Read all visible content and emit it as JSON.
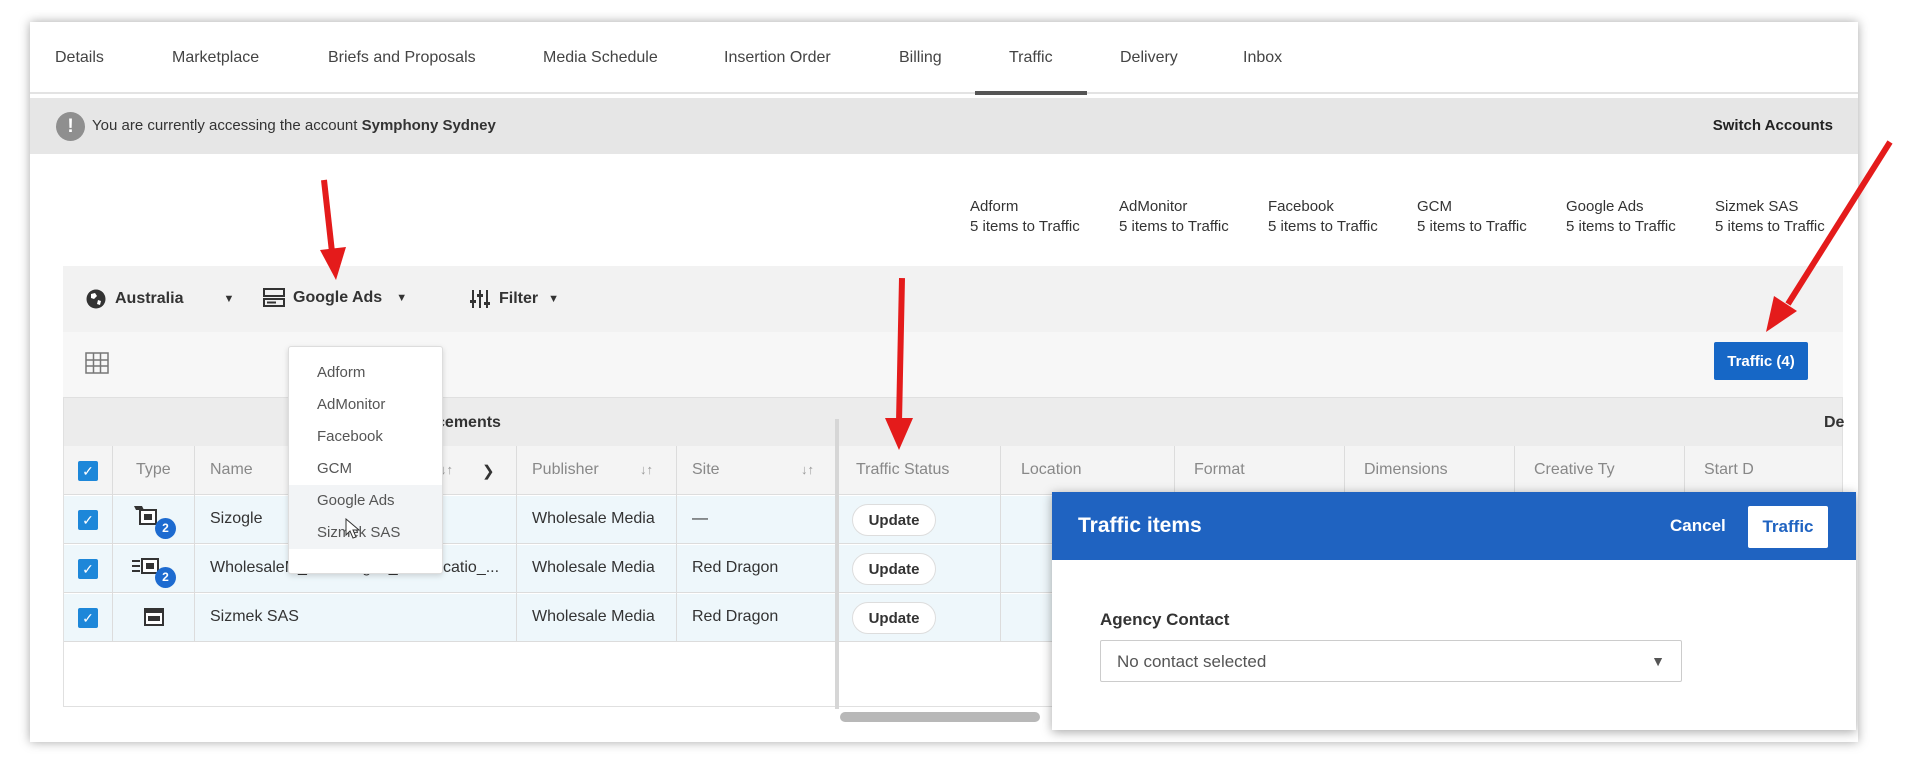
{
  "tabs": [
    {
      "label": "Details"
    },
    {
      "label": "Marketplace"
    },
    {
      "label": "Briefs and Proposals"
    },
    {
      "label": "Media Schedule"
    },
    {
      "label": "Insertion Order"
    },
    {
      "label": "Billing"
    },
    {
      "label": "Traffic",
      "active": true
    },
    {
      "label": "Delivery"
    },
    {
      "label": "Inbox"
    }
  ],
  "notice": {
    "icon": "exclamation-icon",
    "text": "You are currently accessing the account",
    "account": "Symphony Sydney",
    "switch_label": "Switch Accounts"
  },
  "providers": [
    {
      "name": "Adform",
      "count": "5 items to Traffic"
    },
    {
      "name": "AdMonitor",
      "count": "5 items to Traffic"
    },
    {
      "name": "Facebook",
      "count": "5 items to Traffic"
    },
    {
      "name": "GCM",
      "count": "5 items to Traffic"
    },
    {
      "name": "Google Ads",
      "count": "5 items to Traffic"
    },
    {
      "name": "Sizmek SAS",
      "count": "5 items to Traffic"
    }
  ],
  "toolbar": {
    "region": "Australia",
    "adserver": "Google Ads",
    "filter": "Filter",
    "traffic_button": "Traffic (4)"
  },
  "dropdown": {
    "items": [
      "Adform",
      "AdMonitor",
      "Facebook",
      "GCM",
      "Google Ads",
      "Sizmek SAS"
    ],
    "selected": "Google Ads"
  },
  "table": {
    "group_label": "Placements",
    "group_label_right": "De",
    "headers": {
      "type": "Type",
      "name": "Name",
      "publisher": "Publisher",
      "site": "Site",
      "traffic_status": "Traffic Status",
      "location": "Location",
      "format": "Format",
      "dimensions": "Dimensions",
      "creative_type": "Creative Ty",
      "start_date": "Start D"
    },
    "rows": [
      {
        "name": "Sizogle",
        "publisher": "Wholesale Media",
        "site": "—",
        "status": "Update",
        "badge": "2"
      },
      {
        "name": "WholesaleM_RedDragon_SiteLocatio_...",
        "publisher": "Wholesale Media",
        "site": "Red Dragon",
        "status": "Update",
        "badge": "2"
      },
      {
        "name": "Sizmek SAS",
        "publisher": "Wholesale Media",
        "site": "Red Dragon",
        "status": "Update",
        "badge": ""
      }
    ]
  },
  "modal": {
    "title": "Traffic items",
    "cancel": "Cancel",
    "confirm": "Traffic",
    "agency_contact_label": "Agency Contact",
    "agency_contact_value": "No contact selected"
  },
  "colors": {
    "primary": "#1f63c1",
    "button": "#1667c6",
    "checkbox": "#1d87d9",
    "arrow": "#e41b1b"
  }
}
